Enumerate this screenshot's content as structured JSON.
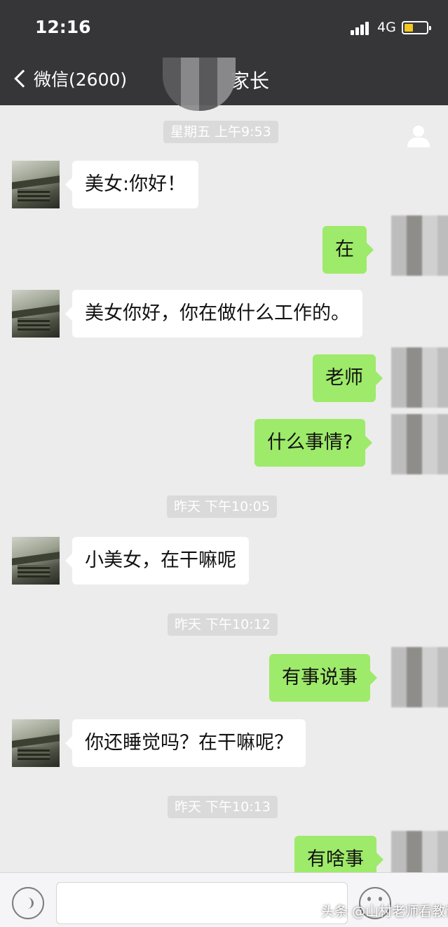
{
  "status_bar": {
    "time": "12:16",
    "network": "4G"
  },
  "nav": {
    "back_label": "微信(2600)",
    "title": "家长"
  },
  "messages": [
    {
      "type": "timestamp",
      "text": "星期五 上午9:53"
    },
    {
      "type": "received",
      "text": "美女:你好！"
    },
    {
      "type": "sent",
      "text": "在"
    },
    {
      "type": "received",
      "text": "美女你好，你在做什么工作的。"
    },
    {
      "type": "sent",
      "text": "老师"
    },
    {
      "type": "sent",
      "text": "什么事情?"
    },
    {
      "type": "timestamp",
      "text": "昨天 下午10:05"
    },
    {
      "type": "received",
      "text": "小美女，在干嘛呢"
    },
    {
      "type": "timestamp",
      "text": "昨天 下午10:12"
    },
    {
      "type": "sent",
      "text": "有事说事"
    },
    {
      "type": "received",
      "text": "你还睡觉吗？在干嘛呢？"
    },
    {
      "type": "timestamp",
      "text": "昨天 下午10:13"
    },
    {
      "type": "sent",
      "text": "有啥事"
    }
  ],
  "watermark": "头条 @山村老师看教育"
}
